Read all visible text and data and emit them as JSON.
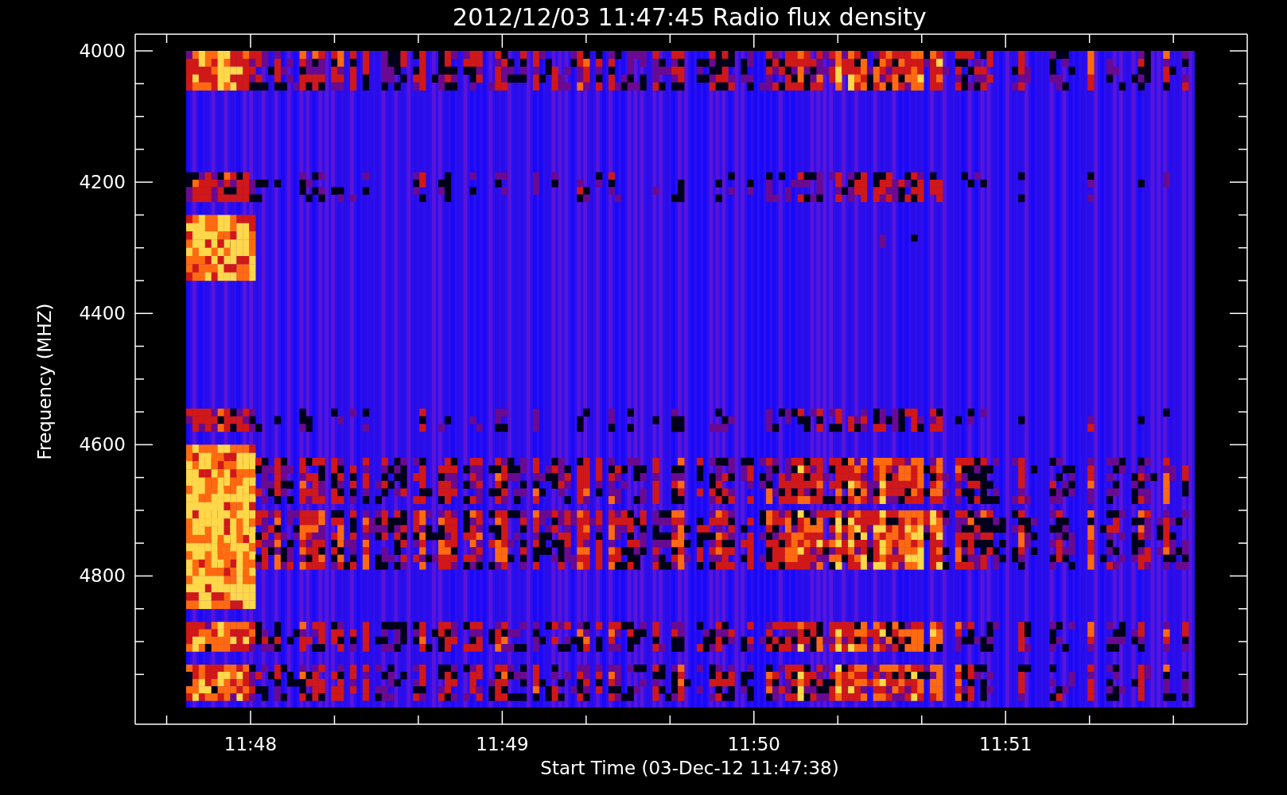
{
  "title": "2012/12/03 11:47:45 Radio flux density",
  "y_axis": {
    "label": "Frequency (MHZ)",
    "ticks": [
      "4000",
      "4200",
      "4400",
      "4600",
      "4800"
    ]
  },
  "x_axis": {
    "label": "Start Time (03-Dec-12 11:47:38)",
    "ticks": [
      "11:48",
      "11:49",
      "11:50",
      "11:51"
    ]
  }
}
